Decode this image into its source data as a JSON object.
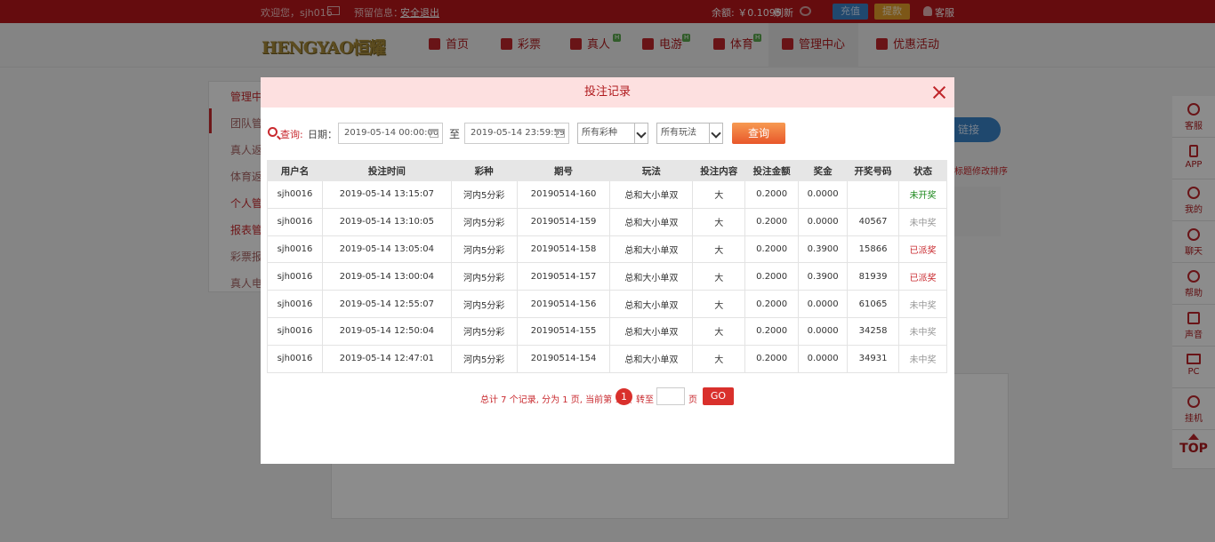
{
  "topbar": {
    "welcome": "欢迎您，sjh016",
    "msg": "预留信息：",
    "logout": "安全退出",
    "balance": "余额: ￥0.1095",
    "refresh": "刷新",
    "recharge": "充值",
    "withdraw": "提款",
    "service": "客服"
  },
  "nav": {
    "logo": "HENGYAO恒耀",
    "items": [
      {
        "label": "首页"
      },
      {
        "label": "彩票"
      },
      {
        "label": "真人",
        "badge": "H"
      },
      {
        "label": "电游",
        "badge": "H"
      },
      {
        "label": "体育",
        "badge": "H"
      },
      {
        "label": "管理中心"
      },
      {
        "label": "优惠活动"
      }
    ]
  },
  "bg": {
    "left_items": [
      "管理中",
      "团队管",
      "真人返",
      "体育返",
      "个人管",
      "报表管",
      "彩票报",
      "真人电"
    ],
    "right_link": "链接",
    "right_note": "标题修改排序"
  },
  "sidebar": {
    "items": [
      "客服",
      "APP",
      "我的",
      "聊天",
      "帮助",
      "声音",
      "PC",
      "挂机"
    ],
    "top": "TOP"
  },
  "modal": {
    "title": "投注记录",
    "filter": {
      "query_label": "查询:",
      "date_label": "日期：",
      "date_from": "2019-05-14 00:00:00",
      "to": "至",
      "date_to": "2019-05-14 23:59:59",
      "lottery_select": "所有彩种",
      "play_select": "所有玩法",
      "query_button": "查询"
    },
    "columns": [
      "用户名",
      "投注时间",
      "彩种",
      "期号",
      "玩法",
      "投注内容",
      "投注金额",
      "奖金",
      "开奖号码",
      "状态"
    ],
    "rows": [
      [
        "sjh0016",
        "2019-05-14 13:15:07",
        "河内5分彩",
        "20190514-160",
        "总和大小单双",
        "大",
        "0.2000",
        "0.0000",
        "",
        "未开奖"
      ],
      [
        "sjh0016",
        "2019-05-14 13:10:05",
        "河内5分彩",
        "20190514-159",
        "总和大小单双",
        "大",
        "0.2000",
        "0.0000",
        "40567",
        "未中奖"
      ],
      [
        "sjh0016",
        "2019-05-14 13:05:04",
        "河内5分彩",
        "20190514-158",
        "总和大小单双",
        "大",
        "0.2000",
        "0.3900",
        "15866",
        "已派奖"
      ],
      [
        "sjh0016",
        "2019-05-14 13:00:04",
        "河内5分彩",
        "20190514-157",
        "总和大小单双",
        "大",
        "0.2000",
        "0.3900",
        "81939",
        "已派奖"
      ],
      [
        "sjh0016",
        "2019-05-14 12:55:07",
        "河内5分彩",
        "20190514-156",
        "总和大小单双",
        "大",
        "0.2000",
        "0.0000",
        "61065",
        "未中奖"
      ],
      [
        "sjh0016",
        "2019-05-14 12:50:04",
        "河内5分彩",
        "20190514-155",
        "总和大小单双",
        "大",
        "0.2000",
        "0.0000",
        "34258",
        "未中奖"
      ],
      [
        "sjh0016",
        "2019-05-14 12:47:01",
        "河内5分彩",
        "20190514-154",
        "总和大小单双",
        "大",
        "0.2000",
        "0.0000",
        "34931",
        "未中奖"
      ]
    ],
    "status_colors": {
      "未开奖": "#1f8a1f",
      "未中奖": "#999999",
      "已派奖": "#c92a2f"
    },
    "pager": {
      "summary": "总计 7 个记录, 分为 1 页, 当前第 1 页",
      "current_page": "1",
      "goto_label": "转至",
      "page_unit": "页",
      "go_button": "GO"
    }
  }
}
